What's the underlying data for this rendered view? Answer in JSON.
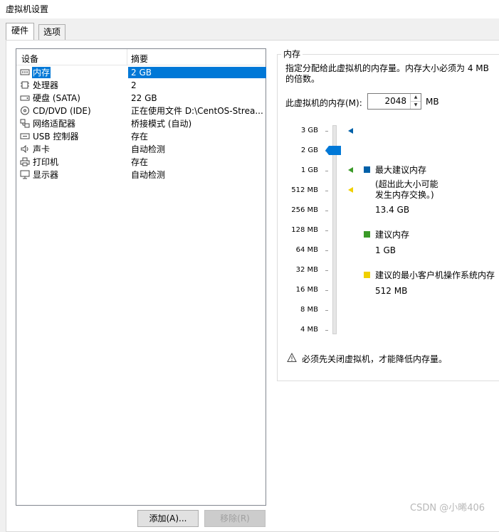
{
  "window": {
    "title": "虚拟机设置"
  },
  "tabs": [
    {
      "label": "硬件",
      "active": true
    },
    {
      "label": "选项",
      "active": false
    }
  ],
  "device_list": {
    "columns": [
      "设备",
      "摘要"
    ],
    "rows": [
      {
        "icon": "memory-icon",
        "name": "内存",
        "summary": "2 GB",
        "selected": true
      },
      {
        "icon": "cpu-icon",
        "name": "处理器",
        "summary": "2"
      },
      {
        "icon": "hard-disk-icon",
        "name": "硬盘 (SATA)",
        "summary": "22 GB"
      },
      {
        "icon": "cd-dvd-icon",
        "name": "CD/DVD (IDE)",
        "summary": "正在使用文件 D:\\CentOS-Strea..."
      },
      {
        "icon": "network-icon",
        "name": "网络适配器",
        "summary": "桥接模式 (自动)"
      },
      {
        "icon": "usb-icon",
        "name": "USB 控制器",
        "summary": "存在"
      },
      {
        "icon": "sound-icon",
        "name": "声卡",
        "summary": "自动检测"
      },
      {
        "icon": "printer-icon",
        "name": "打印机",
        "summary": "存在"
      },
      {
        "icon": "display-icon",
        "name": "显示器",
        "summary": "自动检测"
      }
    ]
  },
  "buttons": {
    "add": "添加(A)...",
    "remove": "移除(R)"
  },
  "memory_panel": {
    "group_title": "内存",
    "description": "指定分配给此虚拟机的内存量。内存大小必须为 4 MB 的倍数。",
    "field_label": "此虚拟机的内存(M):",
    "value": "2048",
    "unit": "MB",
    "scale_ticks": [
      "3 GB",
      "2 GB",
      "1 GB",
      "512 MB",
      "256 MB",
      "128 MB",
      "64 MB",
      "32 MB",
      "16 MB",
      "8 MB",
      "4 MB"
    ],
    "legend": {
      "max_recommended": {
        "color": "#0060a8",
        "label": "最大建议内存",
        "note_line1": "(超出此大小可能",
        "note_line2": "发生内存交换。)",
        "value": "13.4 GB"
      },
      "recommended": {
        "color": "#3a9a28",
        "label": "建议内存",
        "value": "1 GB"
      },
      "min_guest": {
        "color": "#f0d000",
        "label": "建议的最小客户机操作系统内存",
        "value": "512 MB"
      }
    },
    "warning": "必须先关闭虚拟机，才能降低内存量。"
  },
  "watermark": "CSDN @小晞406"
}
